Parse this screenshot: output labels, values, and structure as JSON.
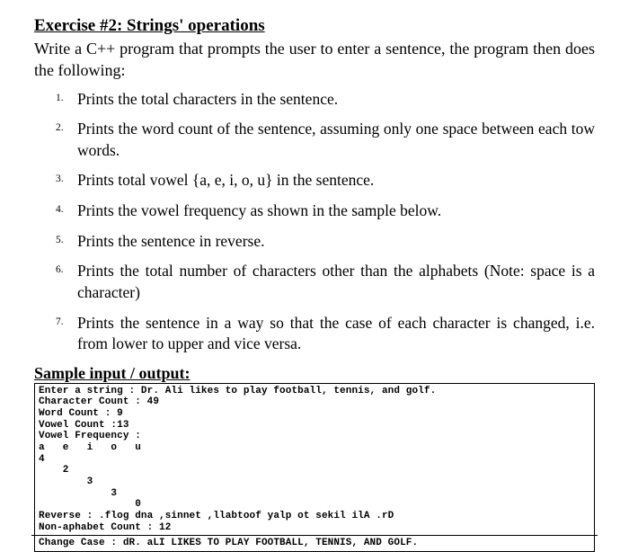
{
  "title": "Exercise #2: Strings' operations",
  "intro": "Write a C++ program that prompts the user to enter a sentence, the program then does the following:",
  "steps": [
    "Prints the total characters in the sentence.",
    "Prints the word count of the sentence, assuming only one space between each tow words.",
    "Prints total vowel {a, e, i, o, u} in the sentence.",
    "Prints the vowel frequency as shown in the sample below.",
    "Prints the sentence in reverse.",
    "Prints the total number of characters other than the alphabets (Note: space is a character)",
    "Prints the sentence in a way so that the case of each character is changed, i.e. from lower to upper and vice versa."
  ],
  "sample_heading": "Sample input / output:",
  "sample_block1": "Enter a string : Dr. Ali likes to play football, tennis, and golf.\nCharacter Count : 49\nWord Count : 9\nVowel Count :13\nVowel Frequency :\na   e   i   o   u\n4\n    2\n        3\n            3\n                0\nReverse : .flog dna ,sinnet ,llabtoof yalp ot sekil ilA .rD\nNon-aphabet Count : 12",
  "sample_block2": "Change Case : dR. aLI LIKES TO PLAY FOOTBALL, TENNIS, AND GOLF."
}
